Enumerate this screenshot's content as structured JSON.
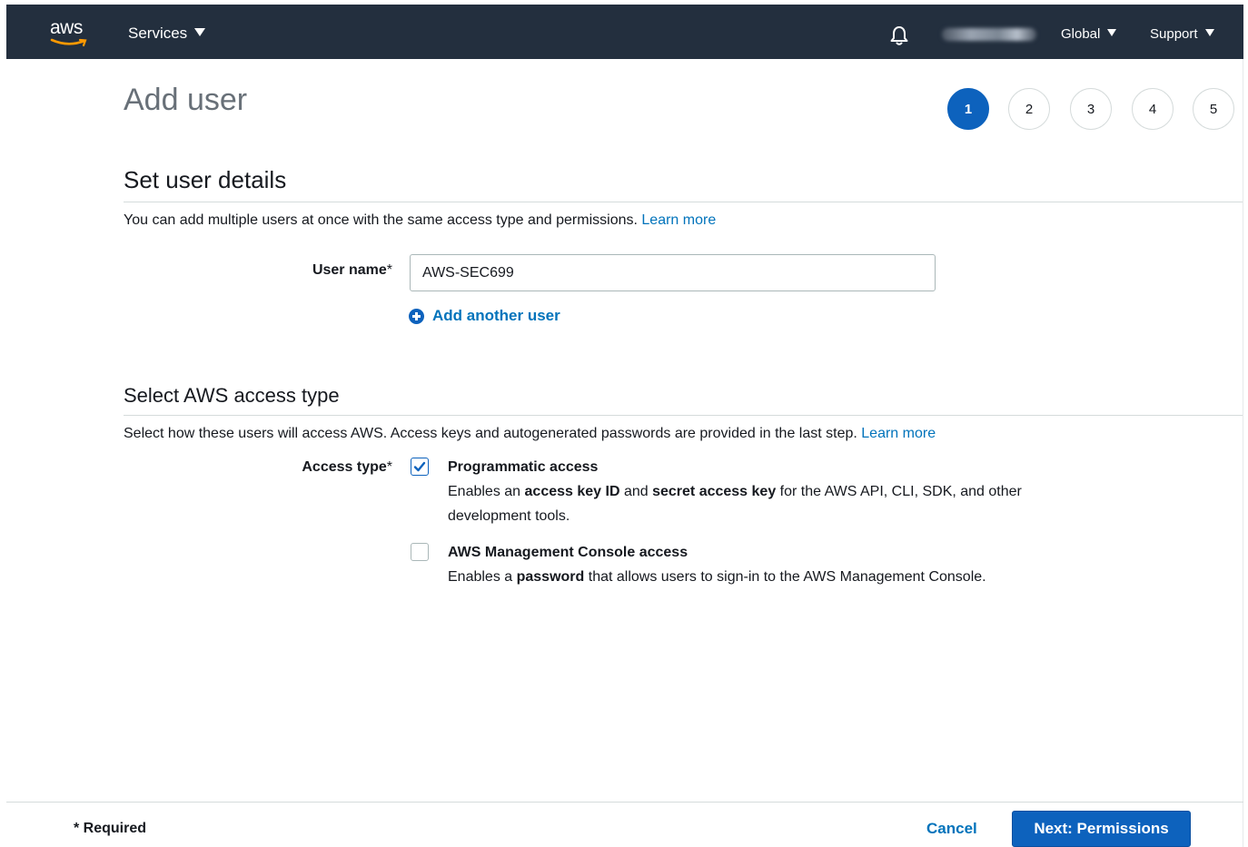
{
  "nav": {
    "logo_text": "aws",
    "services_label": "Services",
    "region_label": "Global",
    "support_label": "Support",
    "icons": {
      "notifications": "bell-icon",
      "dropdown": "caret-down-icon"
    },
    "background_color": "#232f3e"
  },
  "page": {
    "title": "Add user",
    "steps": [
      {
        "label": "1",
        "active": true
      },
      {
        "label": "2",
        "active": false
      },
      {
        "label": "3",
        "active": false
      },
      {
        "label": "4",
        "active": false
      },
      {
        "label": "5",
        "active": false
      }
    ]
  },
  "user_details": {
    "heading": "Set user details",
    "description": "You can add multiple users at once with the same access type and permissions.",
    "learn_more": "Learn more",
    "user_name_label": "User name",
    "required_mark": "*",
    "user_name_value": "AWS-SEC699",
    "add_another_user": "Add another user"
  },
  "access_type": {
    "heading": "Select AWS access type",
    "description": "Select how these users will access AWS. Access keys and autogenerated passwords are provided in the last step.",
    "learn_more": "Learn more",
    "label": "Access type",
    "required_mark": "*",
    "options": [
      {
        "title": "Programmatic access",
        "checked": true,
        "desc_parts": [
          "Enables an ",
          "access key ID",
          " and ",
          "secret access key",
          " for the AWS API, CLI, SDK, and other development tools."
        ]
      },
      {
        "title": "AWS Management Console access",
        "checked": false,
        "desc_parts": [
          "Enables a ",
          "password",
          " that allows users to sign-in to the AWS Management Console."
        ]
      }
    ]
  },
  "footer": {
    "required_note": "* Required",
    "cancel_label": "Cancel",
    "next_label": "Next: Permissions"
  },
  "colors": {
    "primary": "#0d62bd",
    "link": "#0073bb",
    "title_gray": "#687078"
  }
}
